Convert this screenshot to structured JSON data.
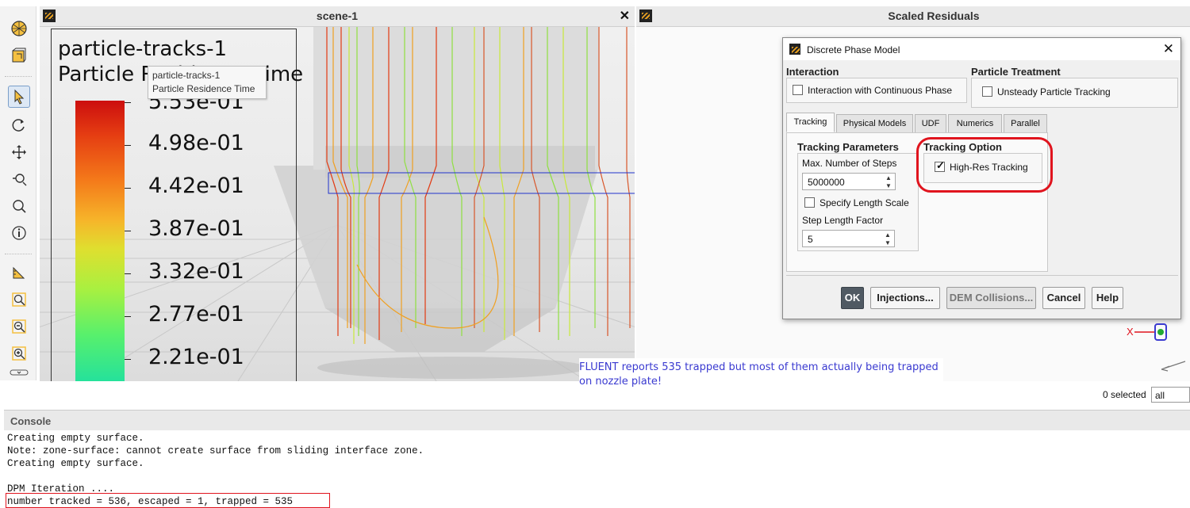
{
  "scene": {
    "title": "scene-1",
    "legend_title_1": "particle-tracks-1",
    "legend_title_2": "Particle Residence Time",
    "legend_ticks": [
      "5.53e-01",
      "4.98e-01",
      "4.42e-01",
      "3.87e-01",
      "3.32e-01",
      "2.77e-01",
      "2.21e-01"
    ],
    "tooltip_line1": "particle-tracks-1",
    "tooltip_line2": "Particle Residence Time"
  },
  "residuals": {
    "title": "Scaled Residuals"
  },
  "dialog": {
    "title": "Discrete Phase Model",
    "interaction_header": "Interaction",
    "interaction_label": "Interaction with Continuous Phase",
    "interaction_checked": false,
    "particle_header": "Particle Treatment",
    "unsteady_label": "Unsteady Particle Tracking",
    "unsteady_checked": false,
    "tabs": [
      "Tracking",
      "Physical Models",
      "UDF",
      "Numerics",
      "Parallel"
    ],
    "active_tab": "Tracking",
    "tracking_params_header": "Tracking Parameters",
    "max_steps_label": "Max. Number of Steps",
    "max_steps_value": "5000000",
    "specify_length_label": "Specify Length Scale",
    "specify_length_checked": false,
    "step_length_label": "Step Length Factor",
    "step_length_value": "5",
    "tracking_option_header": "Tracking Option",
    "highres_label": "High-Res Tracking",
    "highres_checked": true,
    "buttons": {
      "ok": "OK",
      "injections": "Injections...",
      "dem": "DEM Collisions...",
      "cancel": "Cancel",
      "help": "Help"
    }
  },
  "annotation": "FLUENT reports 535 trapped but most of them actually being trapped on nozzle plate!",
  "selection": {
    "count_text": "0 selected",
    "filter": "all"
  },
  "console": {
    "title": "Console",
    "lines": [
      "Creating empty surface.",
      "Note: zone-surface: cannot create surface from sliding interface zone.",
      "Creating empty surface.",
      "",
      "DPM Iteration ....",
      "number tracked = 536, escaped = 1, trapped = 535"
    ]
  },
  "colors": {
    "highlight_red": "#e0141e",
    "annotation_blue": "#3a3ad0",
    "ok_button": "#505a63"
  }
}
